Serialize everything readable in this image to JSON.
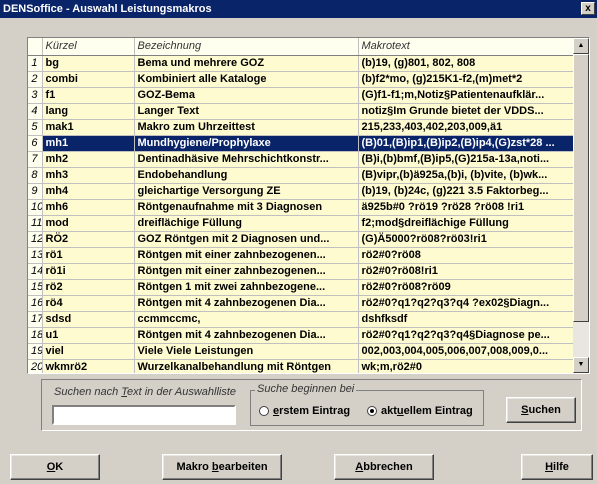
{
  "window": {
    "title": "DENSoffice - Auswahl Leistungsmakros",
    "close_glyph": "x"
  },
  "table": {
    "columns": [
      "Kürzel",
      "Bezeichnung",
      "Makrotext"
    ],
    "selected_index": 5,
    "rows": [
      {
        "num": "1",
        "kuerzel": "bg",
        "bezeichnung": "Bema und mehrere GOZ",
        "makrotext": "(b)19, (g)801, 802, 808"
      },
      {
        "num": "2",
        "kuerzel": "combi",
        "bezeichnung": "Kombiniert alle Kataloge",
        "makrotext": "(b)f2*mo, (g)215K1-f2,(m)met*2"
      },
      {
        "num": "3",
        "kuerzel": "f1",
        "bezeichnung": "GOZ-Bema",
        "makrotext": "(G)f1-f1;m,Notiz§Patientenaufklär..."
      },
      {
        "num": "4",
        "kuerzel": "lang",
        "bezeichnung": "Langer Text",
        "makrotext": "notiz§Im Grunde bietet der VDDS..."
      },
      {
        "num": "5",
        "kuerzel": "mak1",
        "bezeichnung": "Makro zum Uhrzeittest",
        "makrotext": "215,233,403,402,203,009,ä1"
      },
      {
        "num": "6",
        "kuerzel": "mh1",
        "bezeichnung": "Mundhygiene/Prophylaxe",
        "makrotext": "(B)01,(B)ip1,(B)ip2,(B)ip4,(G)zst*28 ..."
      },
      {
        "num": "7",
        "kuerzel": "mh2",
        "bezeichnung": "Dentinadhäsive Mehrschichtkonstr...",
        "makrotext": "(B)i,(b)bmf,(B)ip5,(G)215a-13a,noti..."
      },
      {
        "num": "8",
        "kuerzel": "mh3",
        "bezeichnung": "Endobehandlung",
        "makrotext": "(B)vipr,(b)ä925a,(b)i, (b)vite, (b)wk..."
      },
      {
        "num": "9",
        "kuerzel": "mh4",
        "bezeichnung": "gleichartige Versorgung ZE",
        "makrotext": "(b)19, (b)24c, (g)221 3.5 Faktorbeg..."
      },
      {
        "num": "10",
        "kuerzel": "mh6",
        "bezeichnung": "Röntgenaufnahme mit 3 Diagnosen",
        "makrotext": "ä925b#0 ?rö19 ?rö28  ?rö08 !ri1"
      },
      {
        "num": "11",
        "kuerzel": "mod",
        "bezeichnung": "dreiflächige Füllung",
        "makrotext": "f2;mod§dreiflächige Füllung"
      },
      {
        "num": "12",
        "kuerzel": "RÖ2",
        "bezeichnung": "GOZ Röntgen mit 2 Diagnosen und...",
        "makrotext": "(G)Ä5000?rö08?rö03!ri1"
      },
      {
        "num": "13",
        "kuerzel": "rö1",
        "bezeichnung": "Röntgen mit einer zahnbezogenen...",
        "makrotext": "rö2#0?rö08"
      },
      {
        "num": "14",
        "kuerzel": "rö1i",
        "bezeichnung": "Röntgen mit einer zahnbezogenen...",
        "makrotext": "rö2#0?rö08!ri1"
      },
      {
        "num": "15",
        "kuerzel": "rö2",
        "bezeichnung": "Röntgen 1 mit zwei zahnbezogene...",
        "makrotext": "rö2#0?rö08?rö09"
      },
      {
        "num": "16",
        "kuerzel": "rö4",
        "bezeichnung": "Röntgen mit 4 zahnbezogenen Dia...",
        "makrotext": "rö2#0?q1?q2?q3?q4 ?ex02§Diagn..."
      },
      {
        "num": "17",
        "kuerzel": "sdsd",
        "bezeichnung": "ccmmccmc,",
        "makrotext": "dshfksdf"
      },
      {
        "num": "18",
        "kuerzel": "u1",
        "bezeichnung": "Röntgen mit 4 zahnbezogenen Dia...",
        "makrotext": "rö2#0?q1?q2?q3?q4§Diagnose pe..."
      },
      {
        "num": "19",
        "kuerzel": "viel",
        "bezeichnung": "Viele Viele Leistungen",
        "makrotext": "002,003,004,005,006,007,008,009,0..."
      },
      {
        "num": "20",
        "kuerzel": "wkmrö2",
        "bezeichnung": "Wurzelkanalbehandlung mit Röntgen",
        "makrotext": "wk;m,rö2#0"
      }
    ]
  },
  "search": {
    "label_pre": "Suchen nach ",
    "label_u": "T",
    "label_post": "ext in der Auswahlliste",
    "input_value": "",
    "group_label": "Suche beginnen bei",
    "opt1_u": "e",
    "opt1_rest": "rstem Eintrag",
    "opt2_pre": "akt",
    "opt2_u": "u",
    "opt2_post": "ellem Eintrag",
    "selected_option": "aktuellem Eintrag",
    "btn_u": "S",
    "btn_rest": "uchen"
  },
  "buttons": {
    "ok_u": "O",
    "ok_rest": "K",
    "edit_pre": "Makro ",
    "edit_u": "b",
    "edit_post": "earbeiten",
    "cancel_u": "A",
    "cancel_rest": "bbrechen",
    "help_u": "H",
    "help_rest": "ilfe"
  },
  "icons": {
    "scroll_up": "triangle-up-icon",
    "scroll_down": "triangle-down-icon",
    "close": "close-icon"
  },
  "colors": {
    "title_bg": "#0a246a",
    "row_bg": "#fffbd0",
    "selection_bg": "#0a246a",
    "window_bg": "#d4d0c8"
  }
}
